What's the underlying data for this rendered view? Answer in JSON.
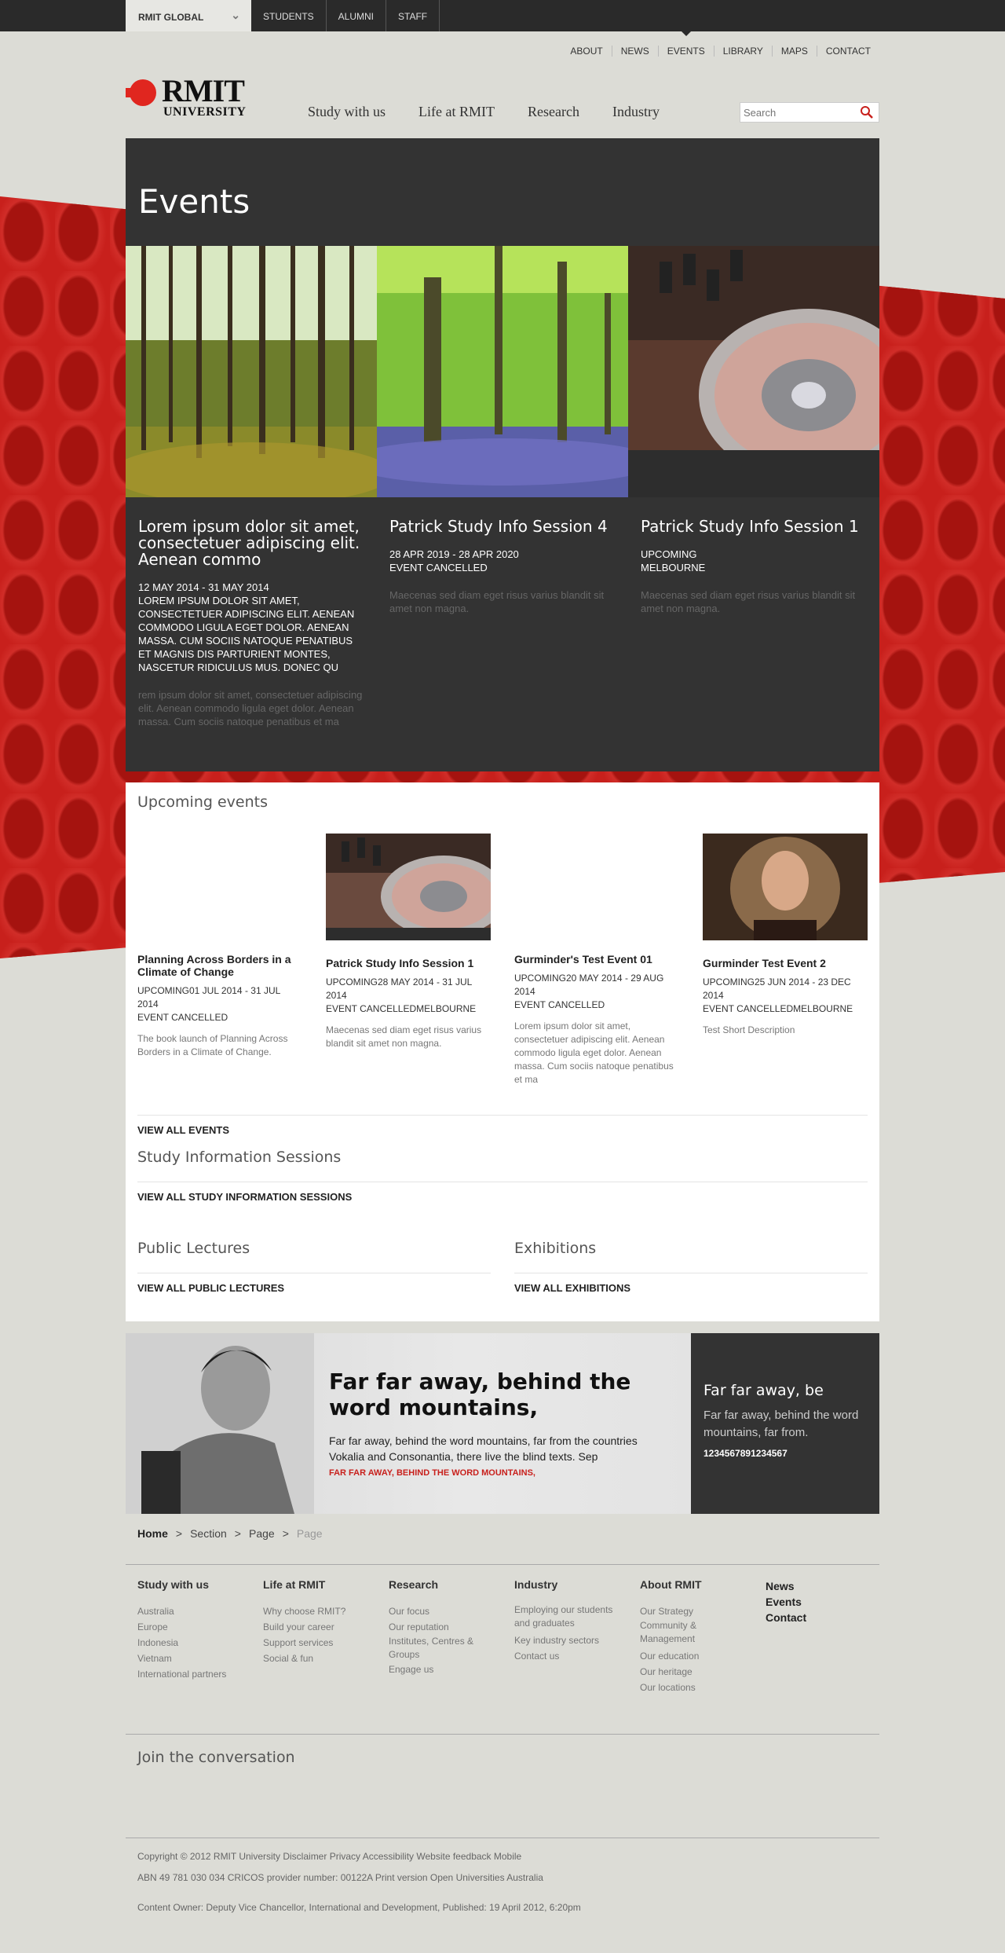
{
  "audience": {
    "current": "RMIT GLOBAL",
    "links": [
      "STUDENTS",
      "ALUMNI",
      "STAFF"
    ]
  },
  "utility": [
    "ABOUT",
    "NEWS",
    "EVENTS",
    "LIBRARY",
    "MAPS",
    "CONTACT"
  ],
  "logo": {
    "name": "RMIT",
    "sub": "UNIVERSITY"
  },
  "main_nav": [
    "Study with us",
    "Life at RMIT",
    "Research",
    "Industry"
  ],
  "search": {
    "placeholder": "Search",
    "value": ""
  },
  "hero": {
    "title": "Events",
    "items": [
      {
        "title": "Lorem ipsum dolor sit amet, consectetuer adipiscing elit. Aenean commo",
        "meta": "12 MAY 2014 - 31 MAY 2014\nLOREM IPSUM DOLOR SIT AMET, CONSECTETUER ADIPISCING ELIT. AENEAN COMMODO LIGULA EGET DOLOR. AENEAN MASSA. CUM SOCIIS NATOQUE PENATIBUS ET MAGNIS DIS PARTURIENT MONTES, NASCETUR RIDICULUS MUS. DONEC QU",
        "desc": "rem ipsum dolor sit amet, consectetuer adipiscing elit. Aenean commodo ligula eget dolor. Aenean massa. Cum sociis natoque penatibus et ma"
      },
      {
        "title": "Patrick Study Info Session 4",
        "meta": "28 APR 2019 - 28 APR 2020\nEVENT CANCELLED",
        "desc": "Maecenas sed diam eget risus varius blandit sit amet non magna."
      },
      {
        "title": "Patrick Study Info Session 1",
        "meta": "UPCOMING\nMELBOURNE",
        "desc": "Maecenas sed diam eget risus varius blandit sit amet non magna."
      }
    ]
  },
  "upcoming": {
    "heading": "Upcoming events",
    "items": [
      {
        "title": "Planning Across Borders in a Climate of Change",
        "meta": "UPCOMING01 JUL 2014 - 31 JUL 2014\nEVENT CANCELLED",
        "desc": "The book launch of Planning Across Borders in a Climate of Change."
      },
      {
        "title": "Patrick Study Info Session 1",
        "meta": "UPCOMING28 MAY 2014 - 31 JUL 2014\nEVENT CANCELLEDMELBOURNE",
        "desc": "Maecenas sed diam eget risus varius blandit sit amet non magna."
      },
      {
        "title": "Gurminder's Test Event 01",
        "meta": "UPCOMING20 MAY 2014 - 29 AUG 2014\nEVENT CANCELLED",
        "desc": "Lorem ipsum dolor sit amet, consectetuer adipiscing elit. Aenean commodo ligula eget dolor. Aenean massa. Cum sociis natoque penatibus et ma"
      },
      {
        "title": "Gurminder Test Event 2",
        "meta": "UPCOMING25 JUN 2014 - 23 DEC 2014\nEVENT CANCELLEDMELBOURNE",
        "desc": "Test Short Description"
      }
    ],
    "view_all": "VIEW ALL EVENTS"
  },
  "study_sessions": {
    "heading": "Study Information Sessions",
    "view_all": "VIEW ALL STUDY INFORMATION SESSIONS"
  },
  "public_lectures": {
    "heading": "Public Lectures",
    "view_all": "VIEW ALL PUBLIC LECTURES"
  },
  "exhibitions": {
    "heading": "Exhibitions",
    "view_all": "VIEW ALL EXHIBITIONS"
  },
  "promo": {
    "title": "Far far away, behind the word mountains,",
    "text": "Far far away, behind the word mountains, far from the countries Vokalia and Consonantia, there live the blind texts. Sep",
    "cta": "FAR FAR AWAY, BEHIND THE WORD MOUNTAINS,",
    "side_title": "Far far away, be",
    "side_text": "Far far away, behind the word mountains, far from.",
    "side_number": "1234567891234567"
  },
  "breadcrumb": [
    "Home",
    "Section",
    "Page",
    "Page"
  ],
  "footer": {
    "columns": [
      {
        "heading": "Study with us",
        "links": [
          "Australia",
          "Europe",
          "Indonesia",
          "Vietnam",
          "International partners"
        ]
      },
      {
        "heading": "Life at RMIT",
        "links": [
          "Why choose RMIT?",
          "Build your career",
          "Support services",
          "Social & fun"
        ]
      },
      {
        "heading": "Research",
        "links": [
          "Our focus",
          "Our reputation",
          "Institutes, Centres & Groups",
          "Engage us"
        ]
      },
      {
        "heading": "Industry",
        "links": [
          "Employing our students and graduates",
          "Key industry sectors",
          "Contact us"
        ]
      },
      {
        "heading": "About RMIT",
        "links": [
          "Our Strategy",
          "Community & Management",
          "Our education",
          "Our heritage",
          "Our locations"
        ]
      }
    ],
    "quick": [
      "News",
      "Events",
      "Contact"
    ],
    "join": "Join the conversation",
    "legal1": "Copyright © 2012 RMIT University Disclaimer Privacy Accessibility Website feedback Mobile",
    "legal2": "ABN 49 781 030 034 CRICOS provider number: 00122A Print version Open Universities Australia",
    "legal3": "Content Owner: Deputy Vice Chancellor, International and Development, Published: 19 April 2012, 6:20pm"
  },
  "colors": {
    "brand_red": "#c8201c",
    "dark_panel": "#333333",
    "page_bg": "#dcdcd6"
  }
}
